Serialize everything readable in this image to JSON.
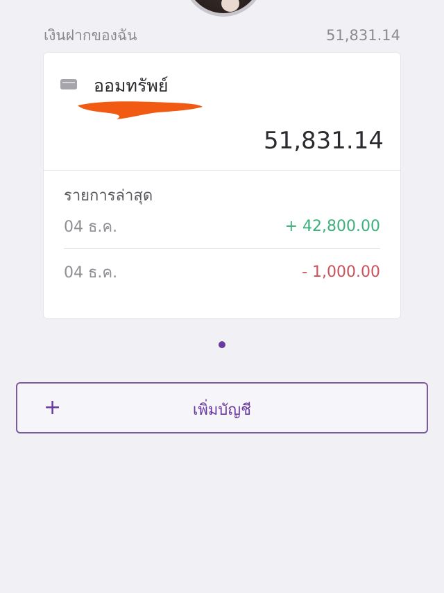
{
  "summary": {
    "label": "เงินฝากของฉัน",
    "total": "51,831.14"
  },
  "account": {
    "icon": "bank-card-icon",
    "name": "ออมทรัพย์",
    "balance": "51,831.14"
  },
  "recent": {
    "title": "รายการล่าสุด",
    "transactions": [
      {
        "date": "04 ธ.ค.",
        "amount": "+ 42,800.00",
        "type": "credit"
      },
      {
        "date": "04 ธ.ค.",
        "amount": "- 1,000.00",
        "type": "debit"
      }
    ]
  },
  "add_account": {
    "icon": "plus-icon",
    "plus_symbol": "+",
    "label": "เพิ่มบัญชี"
  },
  "colors": {
    "accent": "#6b3aa0",
    "credit": "#3bb07a",
    "debit": "#c9515b",
    "redaction": "#f15a13"
  }
}
